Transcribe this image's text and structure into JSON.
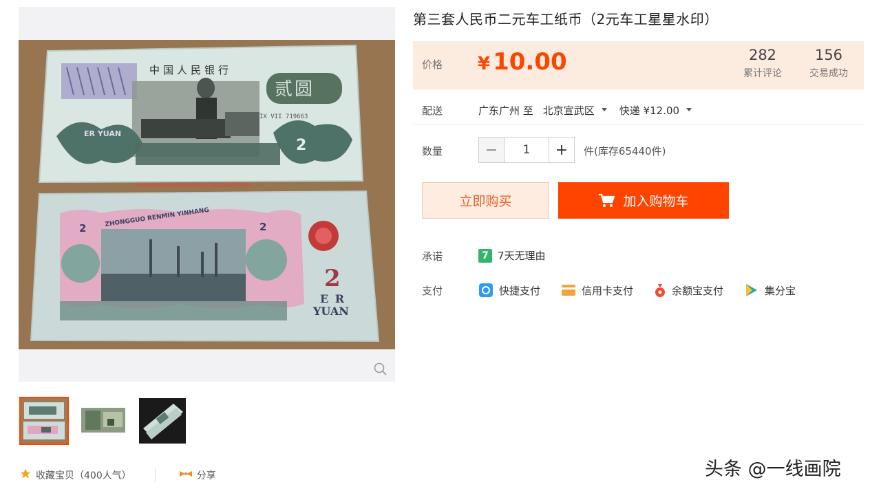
{
  "product": {
    "title": "第三套人民币二元车工纸币（2元车工星星水印）"
  },
  "price": {
    "label": "价格",
    "currency": "¥",
    "value": "10.00",
    "color": "#ff4400",
    "reviews_count": "282",
    "reviews_label": "累计评论",
    "deals_count": "156",
    "deals_label": "交易成功"
  },
  "shipping": {
    "label": "配送",
    "from": "广东广州 至",
    "to": "北京宣武区",
    "method": "快递 ¥12.00"
  },
  "quantity": {
    "label": "数量",
    "minus": "−",
    "value": "1",
    "plus": "+",
    "stock": "件(库存65440件)"
  },
  "actions": {
    "buy_now": "立即购买",
    "add_to_cart": "加入购物车"
  },
  "promise": {
    "label": "承诺",
    "badge": "7",
    "text": "7天无理由"
  },
  "payment": {
    "label": "支付",
    "methods": [
      "快捷支付",
      "信用卡支付",
      "余额宝支付",
      "集分宝"
    ]
  },
  "gallery": {
    "banknote_front_text": "中国人民银行",
    "banknote_front_denomination": "贰圆",
    "banknote_front_serial": "IX VII 719663",
    "banknote_pinyin": "ER YUAN",
    "banknote_numeral": "2",
    "banknote_back_text": "ZHONGGUO RENMIN YINHANG"
  },
  "footer": {
    "favorite": "收藏宝贝（400人气）",
    "share": "分享"
  },
  "watermark": "头条 @一线画院"
}
